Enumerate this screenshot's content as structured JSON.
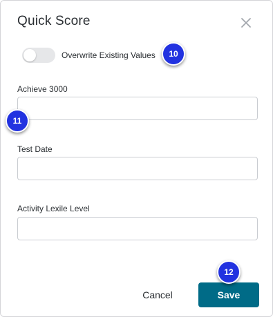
{
  "dialog": {
    "title": "Quick Score",
    "close_icon": "close-icon"
  },
  "overwrite_toggle": {
    "label": "Overwrite Existing Values",
    "enabled": false
  },
  "fields": [
    {
      "label": "Achieve 3000",
      "value": "",
      "placeholder": ""
    },
    {
      "label": "Test Date",
      "value": "",
      "placeholder": ""
    },
    {
      "label": "Activity Lexile Level",
      "value": "",
      "placeholder": ""
    }
  ],
  "actions": {
    "cancel_label": "Cancel",
    "save_label": "Save"
  },
  "callouts": [
    "10",
    "11",
    "12"
  ],
  "colors": {
    "primary": "#006b87",
    "callout": "#2232e0",
    "text": "#2b2f33",
    "border": "#c9ccd1"
  }
}
